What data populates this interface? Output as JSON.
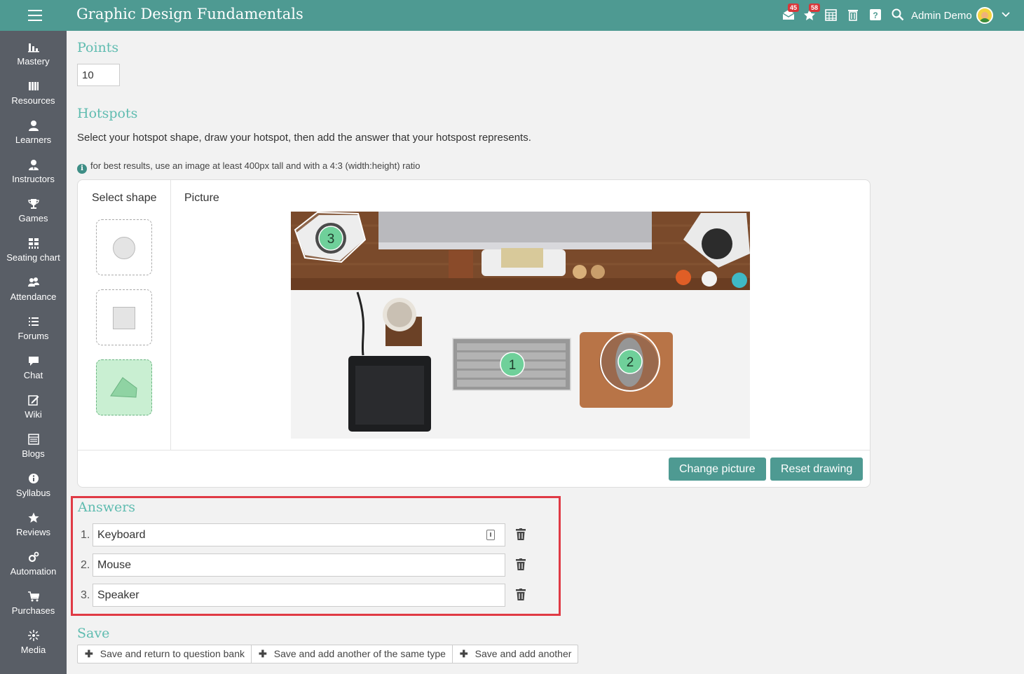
{
  "app": {
    "title": "Graphic Design Fundamentals",
    "user_name": "Admin Demo",
    "mail_badge": "45",
    "notif_badge": "58"
  },
  "colors": {
    "header": "#4e9a92",
    "sidebar": "#595e66",
    "accent_heading": "#5fbcb0",
    "highlight": "#e03a45"
  },
  "sidebar": {
    "items": [
      {
        "label": "Mastery",
        "icon": "bar-chart-icon"
      },
      {
        "label": "Resources",
        "icon": "books-icon"
      },
      {
        "label": "Learners",
        "icon": "user-icon"
      },
      {
        "label": "Instructors",
        "icon": "instructor-icon"
      },
      {
        "label": "Games",
        "icon": "trophy-icon"
      },
      {
        "label": "Seating chart",
        "icon": "seating-icon"
      },
      {
        "label": "Attendance",
        "icon": "group-icon"
      },
      {
        "label": "Forums",
        "icon": "list-icon"
      },
      {
        "label": "Chat",
        "icon": "chat-icon"
      },
      {
        "label": "Wiki",
        "icon": "edit-icon"
      },
      {
        "label": "Blogs",
        "icon": "blog-icon"
      },
      {
        "label": "Syllabus",
        "icon": "info-icon"
      },
      {
        "label": "Reviews",
        "icon": "star-icon"
      },
      {
        "label": "Automation",
        "icon": "gears-icon"
      },
      {
        "label": "Purchases",
        "icon": "cart-icon"
      },
      {
        "label": "Media",
        "icon": "media-icon"
      }
    ]
  },
  "points": {
    "heading": "Points",
    "value": "10"
  },
  "hotspots": {
    "heading": "Hotspots",
    "description": "Select your hotspot shape, draw your hotspot, then add the answer that your hotspost represents.",
    "note": "for best results, use an image at least 400px tall and with a 4:3 (width:height) ratio",
    "select_shape_label": "Select shape",
    "picture_label": "Picture",
    "selected_shape": "polygon",
    "markers": [
      "1",
      "2",
      "3"
    ],
    "change_picture": "Change picture",
    "reset_drawing": "Reset drawing"
  },
  "answers": {
    "heading": "Answers",
    "items": [
      {
        "num": "1.",
        "value": "Keyboard"
      },
      {
        "num": "2.",
        "value": "Mouse"
      },
      {
        "num": "3.",
        "value": "Speaker"
      }
    ]
  },
  "save": {
    "heading": "Save",
    "buttons": [
      "Save and return to question bank",
      "Save and add another of the same type",
      "Save and add another"
    ]
  }
}
